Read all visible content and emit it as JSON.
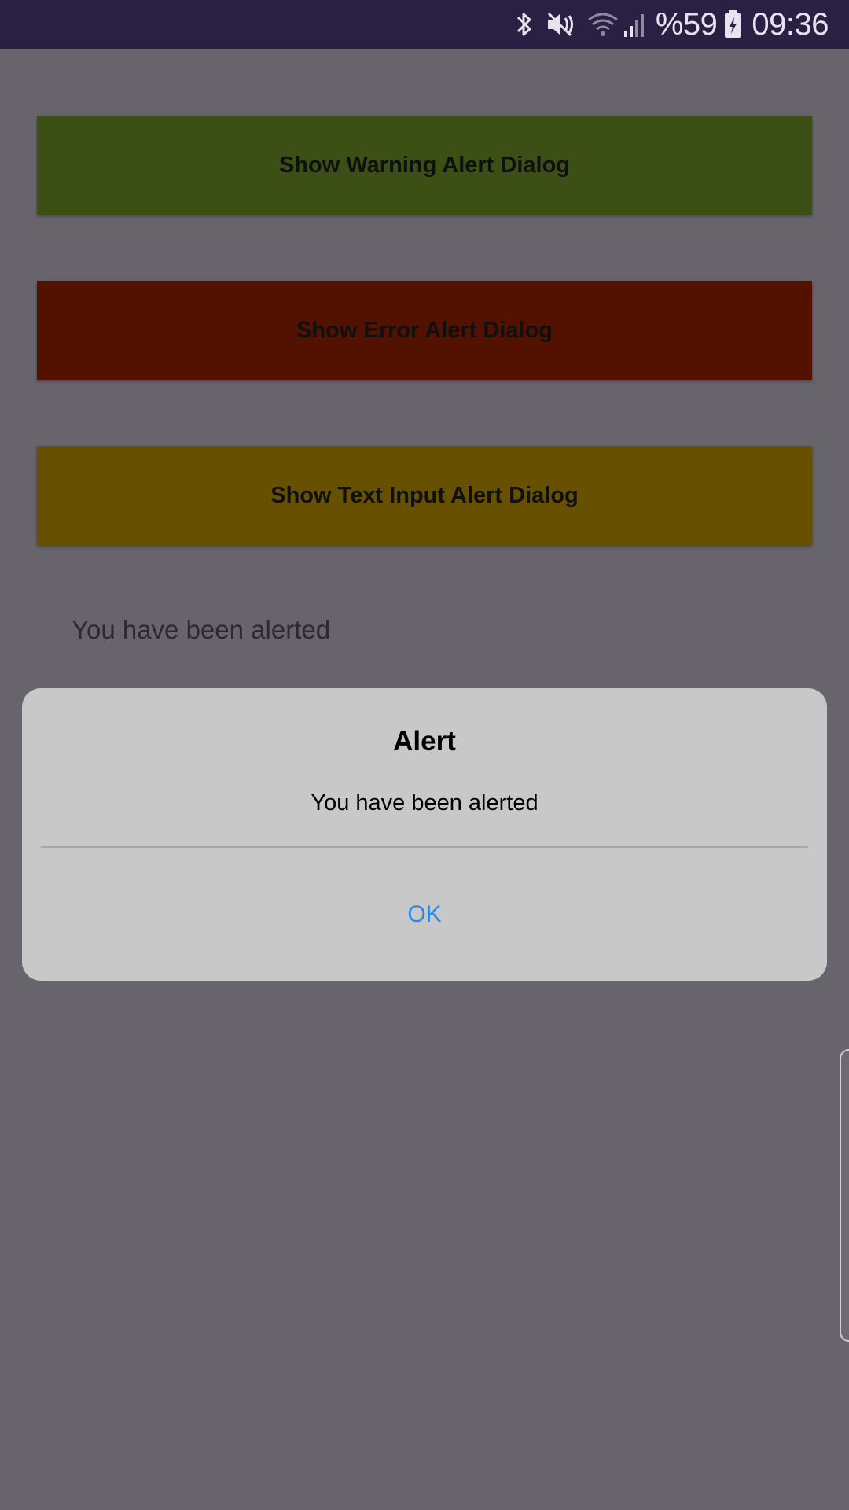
{
  "status_bar": {
    "battery": "%59",
    "time": "09:36",
    "icons": [
      "bluetooth-icon",
      "mute-icon",
      "wifi-icon",
      "signal-icon",
      "battery-charging-icon"
    ]
  },
  "app": {
    "buttons": [
      {
        "label": "Show Warning Alert Dialog",
        "color": "#3c4f15"
      },
      {
        "label": "Show Error Alert Dialog",
        "color": "#531200"
      },
      {
        "label": "Show Text Input Alert Dialog",
        "color": "#675000"
      }
    ],
    "result_text": "You have been alerted"
  },
  "dialog": {
    "title": "Alert",
    "message": "You have been alerted",
    "ok_label": "OK",
    "ok_color": "#2d87ea"
  }
}
